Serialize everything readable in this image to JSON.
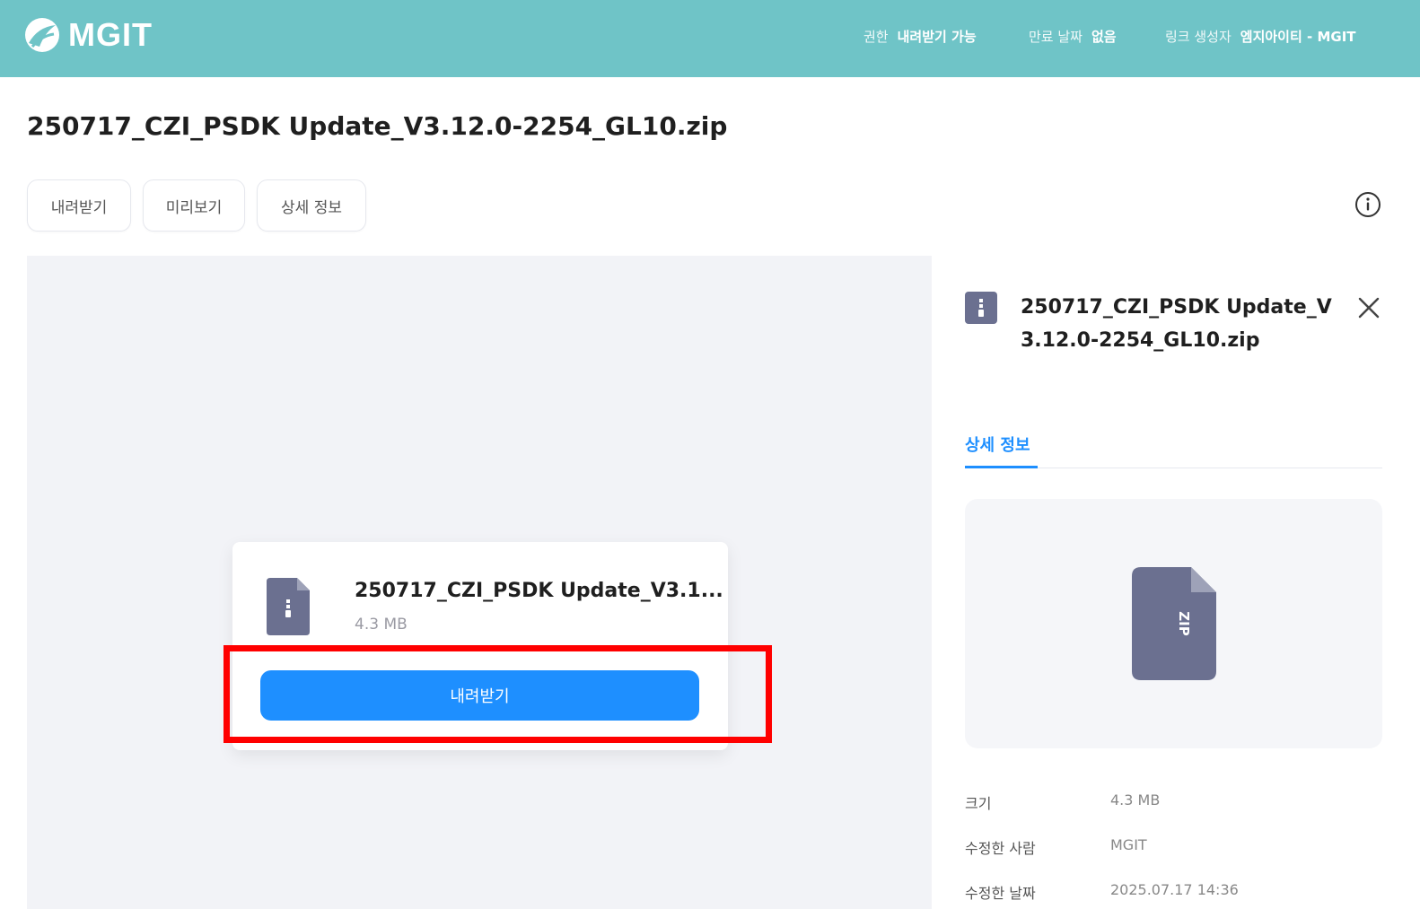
{
  "header": {
    "logo_text": "MGIT",
    "permission_label": "권한",
    "permission_value": "내려받기 가능",
    "expiry_label": "만료 날짜",
    "expiry_value": "없음",
    "creator_label": "링크 생성자",
    "creator_value": "엠지아이티 - MGIT",
    "background_color": "#6fc4c7"
  },
  "file": {
    "title": "250717_CZI_PSDK Update_V3.12.0-2254_GL10.zip",
    "truncated_name": "250717_CZI_PSDK Update_V3.1...",
    "size": "4.3 MB",
    "type_label": "ZIP"
  },
  "toolbar": {
    "download_label": "내려받기",
    "preview_label": "미리보기",
    "details_label": "상세 정보"
  },
  "preview_card": {
    "download_button_label": "내려받기",
    "accent_color": "#1e8fff",
    "highlight_color": "#ff0000"
  },
  "side_panel": {
    "title": "250717_CZI_PSDK Update_V3.12.0-2254_GL10.zip",
    "tab_label": "상세 정보",
    "properties": [
      {
        "label": "크기",
        "value": "4.3 MB"
      },
      {
        "label": "수정한 사람",
        "value": "MGIT"
      },
      {
        "label": "수정한 날짜",
        "value": "2025.07.17 14:36"
      }
    ]
  }
}
